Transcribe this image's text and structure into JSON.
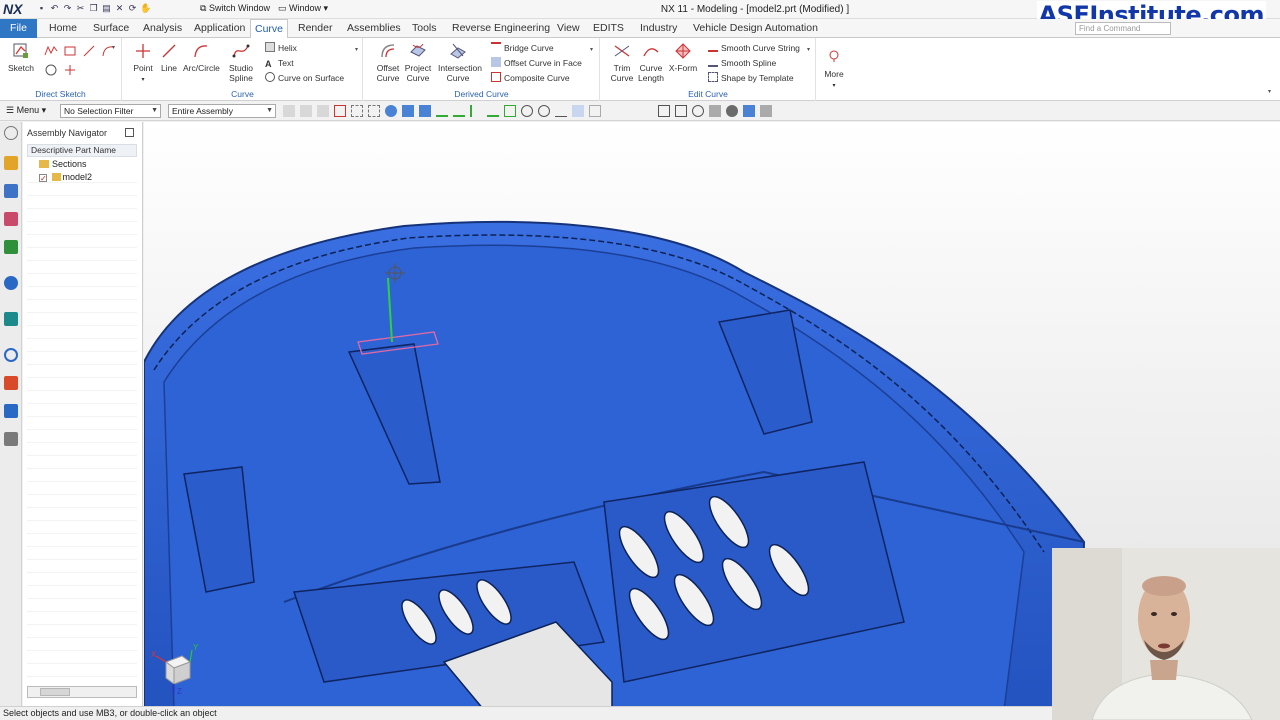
{
  "app": {
    "logo": "NX",
    "window_title": "NX 11 - Modeling - [model2.prt (Modified) ]",
    "switch_window": "Switch Window",
    "window_menu": "Window",
    "brand": "ASEInstitute.com",
    "search_placeholder": "Find a Command"
  },
  "tabs": [
    "File",
    "Home",
    "Surface",
    "Analysis",
    "Application",
    "Curve",
    "Render",
    "Assemblies",
    "Tools",
    "Reverse Engineering",
    "View",
    "EDITS",
    "Industry",
    "Vehicle Design Automation"
  ],
  "active_tab": "Curve",
  "ribbon": {
    "direct_sketch": {
      "label": "Direct Sketch",
      "sketch": "Sketch"
    },
    "curve": {
      "label": "Curve",
      "point": "Point",
      "line": "Line",
      "arc": "Arc/Circle",
      "studio1": "Studio",
      "studio2": "Spline",
      "helix": "Helix",
      "text": "Text",
      "curve_on_surface": "Curve on Surface"
    },
    "derived_curve": {
      "label": "Derived Curve",
      "offset1": "Offset",
      "offset2": "Curve",
      "project1": "Project",
      "project2": "Curve",
      "intersection1": "Intersection",
      "intersection2": "Curve",
      "bridge": "Bridge Curve",
      "offset_in_face": "Offset Curve in Face",
      "composite": "Composite Curve"
    },
    "edit_curve": {
      "label": "Edit Curve",
      "trim1": "Trim",
      "trim2": "Curve",
      "length1": "Curve",
      "length2": "Length",
      "xform": "X-Form",
      "smooth_string": "Smooth Curve String",
      "smooth_spline": "Smooth Spline",
      "shape_template": "Shape by Template"
    },
    "more": "More"
  },
  "selection_bar": {
    "menu": "Menu",
    "filter": "No Selection Filter",
    "scope": "Entire Assembly"
  },
  "navigator": {
    "title": "Assembly Navigator",
    "column": "Descriptive Part Name",
    "items": [
      {
        "label": "Sections"
      },
      {
        "label": "model2"
      }
    ]
  },
  "status": "Select objects and use MB3, or double-click an object",
  "triad": {
    "x": "X",
    "y": "Y",
    "z": "Z"
  },
  "colors": {
    "model": "#2f62d6",
    "accent": "#2f76c5",
    "brand": "#1237a8"
  }
}
